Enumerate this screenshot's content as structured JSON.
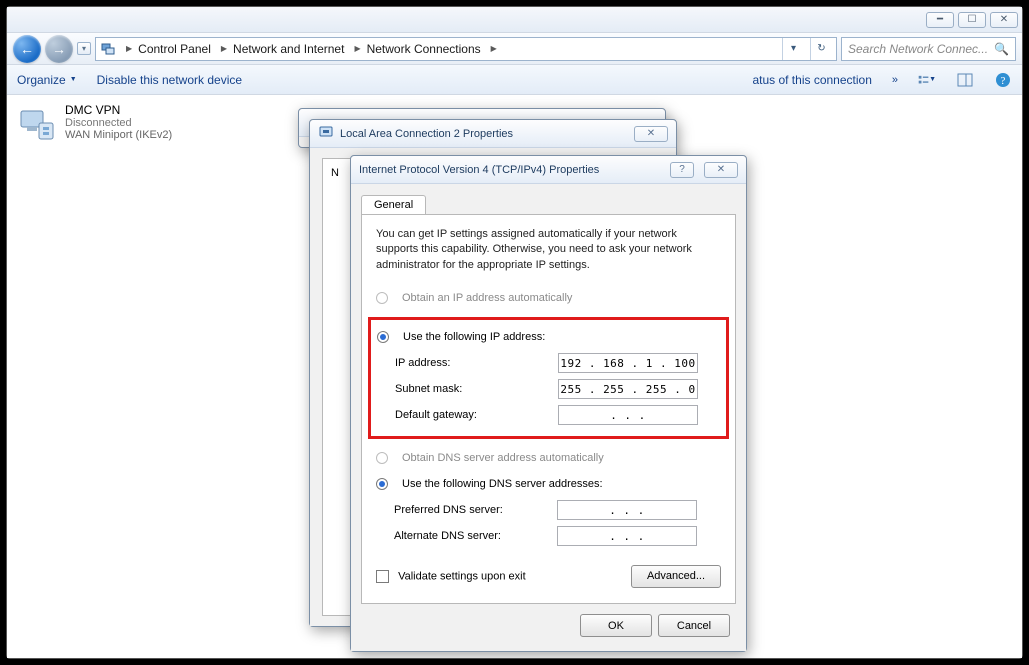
{
  "window": {
    "breadcrumb": [
      "Control Panel",
      "Network and Internet",
      "Network Connections"
    ],
    "search_placeholder": "Search Network Connec...",
    "toolbar": {
      "organize": "Organize",
      "disable": "Disable this network device",
      "status": "atus of this connection"
    }
  },
  "connection": {
    "name": "DMC VPN",
    "status": "Disconnected",
    "device": "WAN Miniport (IKEv2)"
  },
  "dialog1_title": "",
  "dialog2": {
    "title": "Local Area Connection 2 Properties",
    "letter": "N"
  },
  "tcpip": {
    "title": "Internet Protocol Version 4 (TCP/IPv4) Properties",
    "tab": "General",
    "description": "You can get IP settings assigned automatically if your network supports this capability. Otherwise, you need to ask your network administrator for the appropriate IP settings.",
    "radio_obtain_ip": "Obtain an IP address automatically",
    "radio_use_ip": "Use the following IP address:",
    "ip_label": "IP address:",
    "ip_value": "192 . 168 .  1  . 100",
    "subnet_label": "Subnet mask:",
    "subnet_value": "255 . 255 . 255 .  0",
    "gateway_label": "Default gateway:",
    "gateway_value": ".       .       .",
    "radio_obtain_dns": "Obtain DNS server address automatically",
    "radio_use_dns": "Use the following DNS server addresses:",
    "pref_dns_label": "Preferred DNS server:",
    "pref_dns_value": ".       .       .",
    "alt_dns_label": "Alternate DNS server:",
    "alt_dns_value": ".       .       .",
    "validate": "Validate settings upon exit",
    "advanced": "Advanced...",
    "ok": "OK",
    "cancel": "Cancel"
  }
}
